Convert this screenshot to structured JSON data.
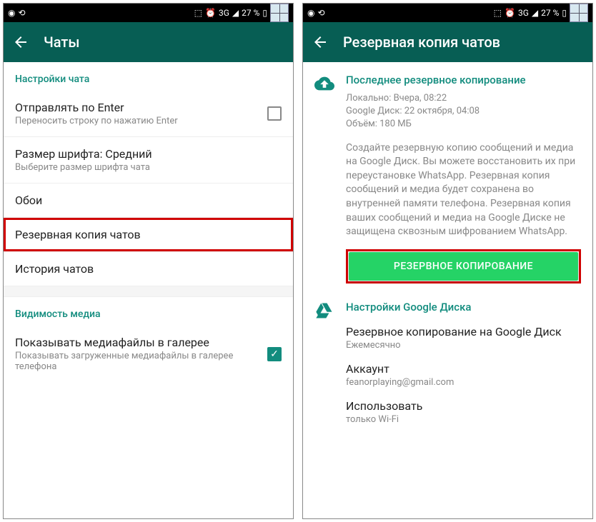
{
  "status": {
    "battery": "27 %",
    "network": "3G"
  },
  "left": {
    "title": "Чаты",
    "section1": "Настройки чата",
    "item_enter_title": "Отправлять по Enter",
    "item_enter_sub": "Переносить строку по нажатию Enter",
    "item_font_title": "Размер шрифта: Средний",
    "item_font_sub": "Выберите размер шрифта чата",
    "item_wallpaper": "Обои",
    "item_backup": "Резервная копия чатов",
    "item_history": "История чатов",
    "section2": "Видимость медиа",
    "item_media_title": "Показывать медиафайлы в галерее",
    "item_media_sub": "Показывать загруженные медиафайлы в галерее телефона"
  },
  "right": {
    "title": "Резервная копия чатов",
    "backup_header": "Последнее резервное копирование",
    "meta_local": "Локально: Вчера, 08:22",
    "meta_gdrive": "Google Диск: 22 октября, 04:08",
    "meta_size": "Объём: 180 МБ",
    "desc": "Создайте резервную копию сообщений и медиа на Google Диск. Вы можете восстановить их при переустановке WhatsApp. Резервная копия сообщений и медиа будет сохранена во внутренней памяти телефона. Резервная копия ваших сообщений и медиа на Google Диске не защищена сквозным шифрованием WhatsApp.",
    "btn": "РЕЗЕРВНОЕ КОПИРОВАНИЕ",
    "gdrive_header": "Настройки Google Диска",
    "gdrive_backup_title": "Резервное копирование на Google Диск",
    "gdrive_backup_sub": "Ежемесячно",
    "gdrive_account_title": "Аккаунт",
    "gdrive_account_sub": "feanorplaying@gmail.com",
    "gdrive_use_title": "Использовать",
    "gdrive_use_sub": "только Wi-Fi"
  }
}
